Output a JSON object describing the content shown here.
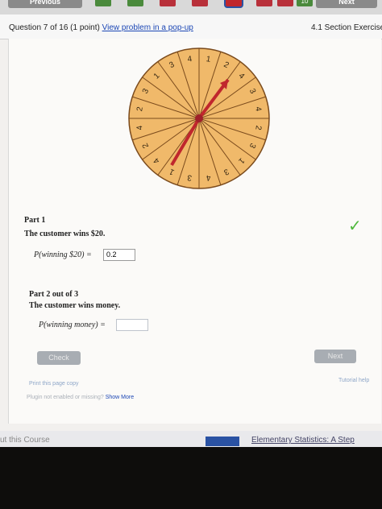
{
  "nav": {
    "prev_label": "Previous",
    "next_label": "Next",
    "qnums": [
      "",
      "",
      "",
      "",
      "",
      "",
      "",
      "10"
    ]
  },
  "header": {
    "question": "Question 7 of 16 (1 point)",
    "view_link": "View problem in a pop-up",
    "section": "4.1 Section Exercise"
  },
  "wheel": {
    "numbers": [
      "1",
      "2",
      "4",
      "3",
      "4",
      "2",
      "3",
      "1",
      "3",
      "4",
      "3",
      "1",
      "4",
      "2",
      "4",
      "2",
      "3",
      "1",
      "3",
      "4"
    ],
    "colors": {
      "fill": "#f0b96a",
      "arrow": "#c0272d"
    }
  },
  "part1": {
    "label": "Part 1",
    "text": "The customer wins $20.",
    "prob_label": "P(winning $20) =",
    "answer": "0.2"
  },
  "part2": {
    "label": "Part 2 out of 3",
    "text": "The customer wins money.",
    "prob_label": "P(winning money) ="
  },
  "buttons": {
    "check": "Check",
    "next": "Next"
  },
  "links": {
    "print": "Print this page copy",
    "tutorial": "Tutorial help"
  },
  "plugin": {
    "text": "Plugin not enabled or missing?",
    "link": "Show More"
  },
  "footer": {
    "left": "ut this Course",
    "right": "Elementary Statistics: A Step"
  }
}
